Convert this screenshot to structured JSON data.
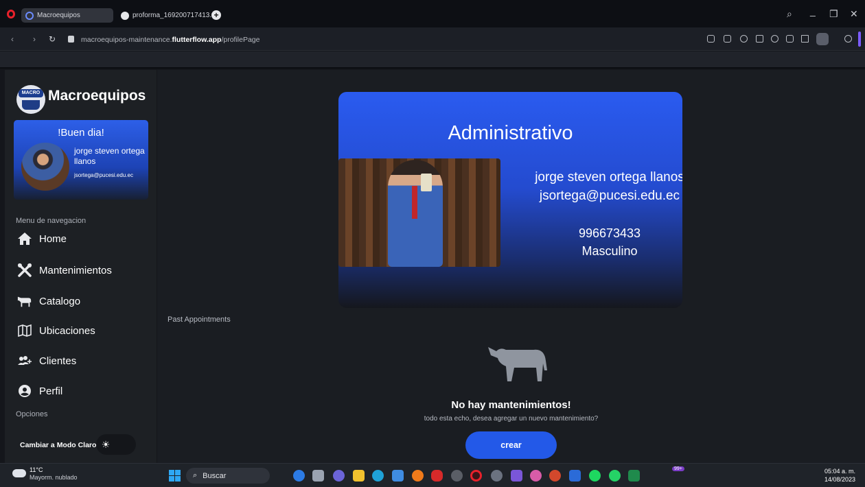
{
  "browser": {
    "tabs": [
      {
        "label": "Macroequipos",
        "active": true
      },
      {
        "label": "proforma_169200717413...",
        "active": false
      }
    ],
    "new_tab": "+",
    "url_prefix": "macroequipos-maintenance.",
    "url_domain": "flutterflow.app",
    "url_path": "/profilePage",
    "window_controls": {
      "search": "⌕",
      "minimize": "_",
      "restore": "❐",
      "close": "✕"
    },
    "nav": {
      "back": "‹",
      "forward": "›",
      "reload": "↻"
    }
  },
  "sidebar": {
    "brand": "Macroequipos",
    "logo_text": "MACRO",
    "greeting": "!Buen dia!",
    "user_name": "jorge steven ortega llanos",
    "user_email": "jsortega@pucesi.edu.ec",
    "nav_section": "Menu de navegacion",
    "items": [
      {
        "label": "Home",
        "icon": "home-icon"
      },
      {
        "label": "Mantenimientos",
        "icon": "tools-icon"
      },
      {
        "label": "Catalogo",
        "icon": "cow-icon"
      },
      {
        "label": "Ubicaciones",
        "icon": "map-icon"
      },
      {
        "label": "Clientes",
        "icon": "add-people-icon"
      },
      {
        "label": "Perfil",
        "icon": "account-circle-icon"
      }
    ],
    "options_section": "Opciones",
    "mode_label": "Cambiar a Modo Claro"
  },
  "profile": {
    "role": "Administrativo",
    "name": "jorge steven ortega llanos",
    "email": "jsortega@pucesi.edu.ec",
    "phone": "996673433",
    "gender": "Masculino"
  },
  "appointments": {
    "section_label": "Past Appointments",
    "empty_title": "No hay mantenimientos!",
    "empty_subtitle": "todo esta echo, desea agregar un nuevo mantenimiento?",
    "create_button": "crear"
  },
  "taskbar": {
    "temperature": "11°C",
    "condition": "Mayorm. nublado",
    "search_label": "Buscar",
    "notification_badge": "99+",
    "time": "05:04 a. m.",
    "date": "14/08/2023"
  },
  "colors": {
    "accent": "#2359e8",
    "card_top": "#2a5bf0",
    "background": "#1a1d22",
    "sidebar": "#1d2024"
  }
}
